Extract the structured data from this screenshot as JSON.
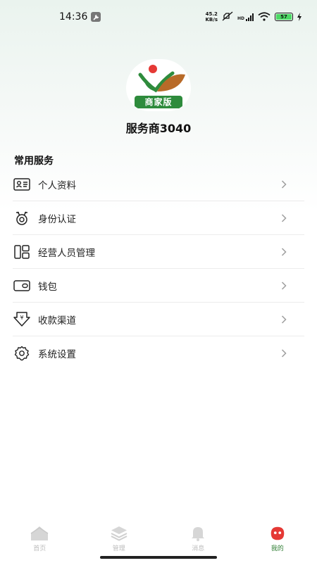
{
  "status_bar": {
    "time": "14:36",
    "net_speed_value": "45.2",
    "net_speed_unit": "KB/s",
    "signal_label": "HD",
    "battery_level": "57",
    "icons": [
      "wrench-icon",
      "mute-icon",
      "signal-icon",
      "wifi-icon",
      "battery-icon",
      "charging-icon"
    ]
  },
  "profile": {
    "logo_text": "商家版",
    "name": "服务商3040"
  },
  "services": {
    "title": "常用服务",
    "items": [
      {
        "label": "个人资料",
        "icon": "id-card-icon"
      },
      {
        "label": "身份认证",
        "icon": "medal-icon"
      },
      {
        "label": "经营人员管理",
        "icon": "staff-grid-icon"
      },
      {
        "label": "钱包",
        "icon": "wallet-icon"
      },
      {
        "label": "收款渠道",
        "icon": "payment-channel-icon"
      },
      {
        "label": "系统设置",
        "icon": "settings-gear-icon"
      }
    ]
  },
  "tab_bar": {
    "tabs": [
      {
        "label": "首页",
        "icon": "home-icon",
        "active": false
      },
      {
        "label": "管理",
        "icon": "layers-icon",
        "active": false
      },
      {
        "label": "消息",
        "icon": "bell-icon",
        "active": false
      },
      {
        "label": "我的",
        "icon": "profile-face-icon",
        "active": true
      }
    ]
  },
  "colors": {
    "brand_green": "#2e7d32",
    "active_tab_icon": "#e53935",
    "inactive_tab": "#bdbdbd"
  }
}
